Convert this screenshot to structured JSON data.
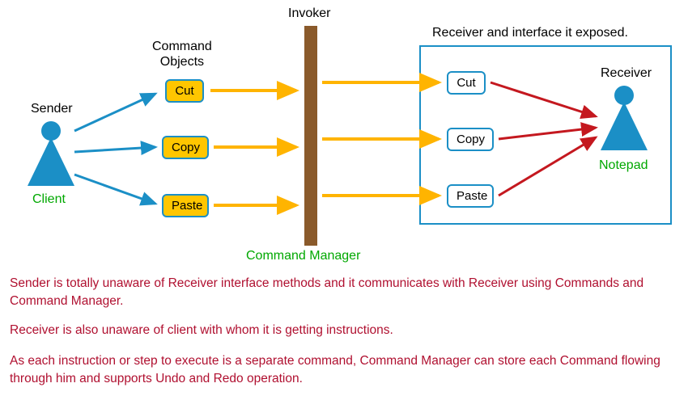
{
  "labels": {
    "invoker": "Invoker",
    "command_objects": "Command\nObjects",
    "sender": "Sender",
    "client": "Client",
    "command_manager": "Command Manager",
    "receiver_interface": "Receiver and interface it exposed.",
    "receiver": "Receiver",
    "notepad": "Notepad"
  },
  "commands": {
    "cut": "Cut",
    "copy": "Copy",
    "paste": "Paste"
  },
  "receiver_commands": {
    "cut": "Cut",
    "copy": "Copy",
    "paste": "Paste"
  },
  "descriptions": {
    "p1": "Sender is totally unaware of Receiver interface methods and it communicates with Receiver using Commands and Command Manager.",
    "p2": "Receiver is also unaware of client with whom it is getting instructions.",
    "p3": "As each instruction or step to execute is a separate command, Command Manager can store each Command flowing through him and supports Undo and Redo operation."
  },
  "colors": {
    "blue": "#1b8fc6",
    "brown": "#8a5a2b",
    "yellow": "#ffc600",
    "green": "#00a800",
    "red_arrow": "#c4181f",
    "orange_arrow": "#ffb400",
    "blue_arrow": "#1b8fc6",
    "desc_text": "#b01030"
  }
}
